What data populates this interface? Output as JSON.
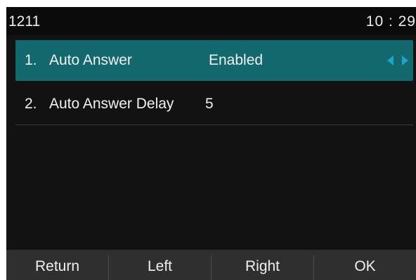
{
  "status_bar": {
    "extension": "1211",
    "time": "10 : 29"
  },
  "menu": {
    "items": [
      {
        "number": "1.",
        "label": "Auto Answer",
        "value": "Enabled",
        "selected": true
      },
      {
        "number": "2.",
        "label": "Auto Answer Delay",
        "value": "5",
        "selected": false
      }
    ]
  },
  "softkeys": {
    "return": "Return",
    "left": "Left",
    "right": "Right",
    "ok": "OK"
  },
  "colors": {
    "selected_row": "#12686d",
    "arrow_accent": "#1aa6c7",
    "background": "#121212",
    "softkey_bar": "#2f2f2f"
  },
  "icons": {
    "value_switch": [
      "arrow-left-icon",
      "arrow-right-icon"
    ]
  }
}
